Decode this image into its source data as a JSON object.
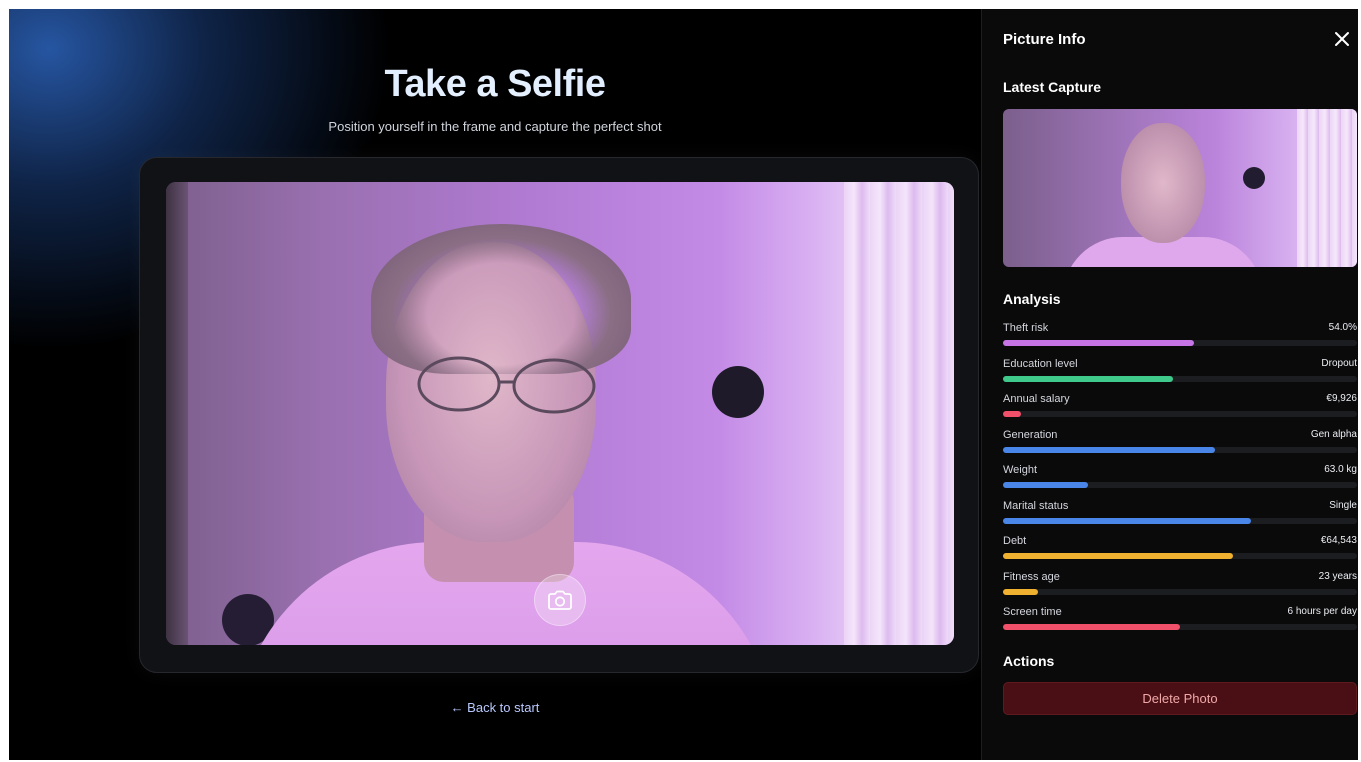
{
  "main": {
    "title": "Take a Selfie",
    "subtitle": "Position yourself in the frame and capture the perfect shot",
    "back_link": "← Back to start",
    "shutter_icon": "camera-icon"
  },
  "sidebar": {
    "title": "Picture Info",
    "close_icon": "close-icon",
    "latest_capture_heading": "Latest Capture",
    "analysis_heading": "Analysis",
    "actions_heading": "Actions",
    "delete_label": "Delete Photo",
    "metrics": [
      {
        "label": "Theft risk",
        "value": "54.0%",
        "fill": 0.54,
        "color": "#c774e6"
      },
      {
        "label": "Education level",
        "value": "Dropout",
        "fill": 0.48,
        "color": "#3fc98a"
      },
      {
        "label": "Annual salary",
        "value": "€9,926",
        "fill": 0.05,
        "color": "#f0506a"
      },
      {
        "label": "Generation",
        "value": "Gen alpha",
        "fill": 0.6,
        "color": "#4a86e8"
      },
      {
        "label": "Weight",
        "value": "63.0 kg",
        "fill": 0.24,
        "color": "#4a86e8"
      },
      {
        "label": "Marital status",
        "value": "Single",
        "fill": 0.7,
        "color": "#4a86e8"
      },
      {
        "label": "Debt",
        "value": "€64,543",
        "fill": 0.65,
        "color": "#f0b030"
      },
      {
        "label": "Fitness age",
        "value": "23 years",
        "fill": 0.1,
        "color": "#f0b030"
      },
      {
        "label": "Screen time",
        "value": "6 hours per day",
        "fill": 0.5,
        "color": "#f0506a"
      }
    ]
  }
}
